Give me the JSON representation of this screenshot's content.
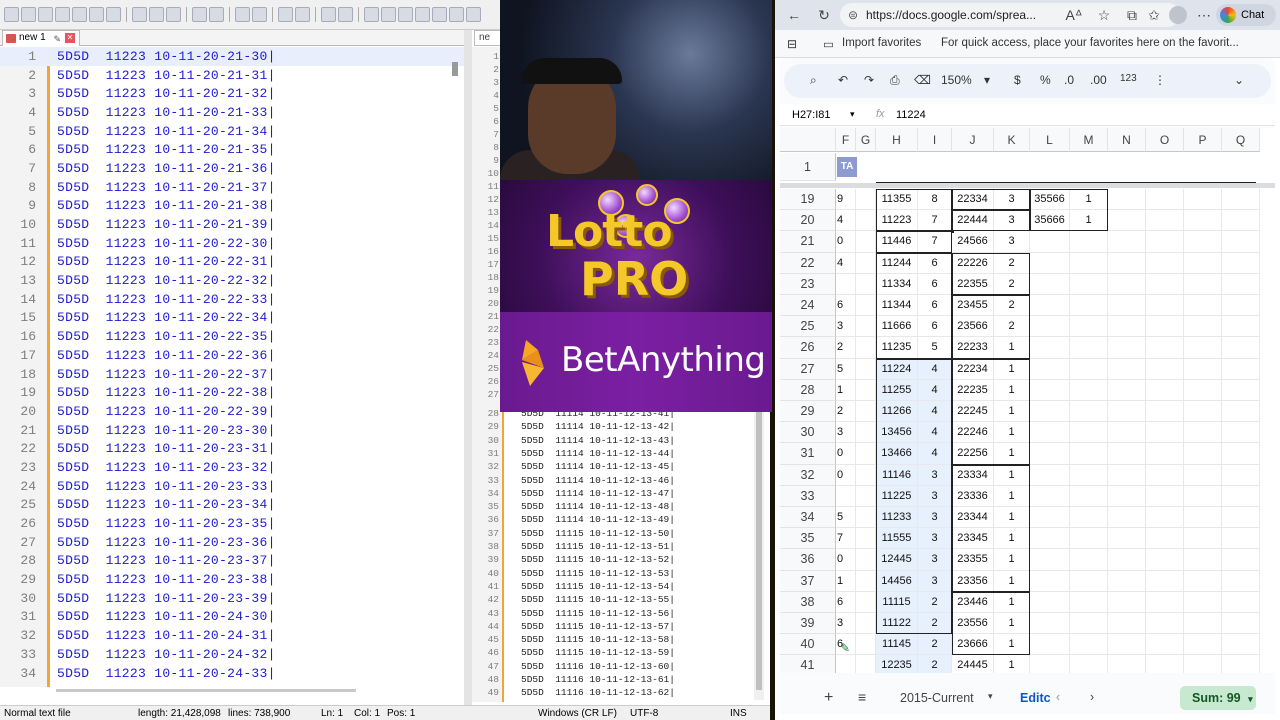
{
  "notepad_left": {
    "tab_label": "new 1",
    "lines": [
      {
        "n": "1",
        "t": "5D5D  11223 10-11-20-21-30|"
      },
      {
        "n": "2",
        "t": "5D5D  11223 10-11-20-21-31|"
      },
      {
        "n": "3",
        "t": "5D5D  11223 10-11-20-21-32|"
      },
      {
        "n": "4",
        "t": "5D5D  11223 10-11-20-21-33|"
      },
      {
        "n": "5",
        "t": "5D5D  11223 10-11-20-21-34|"
      },
      {
        "n": "6",
        "t": "5D5D  11223 10-11-20-21-35|"
      },
      {
        "n": "7",
        "t": "5D5D  11223 10-11-20-21-36|"
      },
      {
        "n": "8",
        "t": "5D5D  11223 10-11-20-21-37|"
      },
      {
        "n": "9",
        "t": "5D5D  11223 10-11-20-21-38|"
      },
      {
        "n": "10",
        "t": "5D5D  11223 10-11-20-21-39|"
      },
      {
        "n": "11",
        "t": "5D5D  11223 10-11-20-22-30|"
      },
      {
        "n": "12",
        "t": "5D5D  11223 10-11-20-22-31|"
      },
      {
        "n": "13",
        "t": "5D5D  11223 10-11-20-22-32|"
      },
      {
        "n": "14",
        "t": "5D5D  11223 10-11-20-22-33|"
      },
      {
        "n": "15",
        "t": "5D5D  11223 10-11-20-22-34|"
      },
      {
        "n": "16",
        "t": "5D5D  11223 10-11-20-22-35|"
      },
      {
        "n": "17",
        "t": "5D5D  11223 10-11-20-22-36|"
      },
      {
        "n": "18",
        "t": "5D5D  11223 10-11-20-22-37|"
      },
      {
        "n": "19",
        "t": "5D5D  11223 10-11-20-22-38|"
      },
      {
        "n": "20",
        "t": "5D5D  11223 10-11-20-22-39|"
      },
      {
        "n": "21",
        "t": "5D5D  11223 10-11-20-23-30|"
      },
      {
        "n": "22",
        "t": "5D5D  11223 10-11-20-23-31|"
      },
      {
        "n": "23",
        "t": "5D5D  11223 10-11-20-23-32|"
      },
      {
        "n": "24",
        "t": "5D5D  11223 10-11-20-23-33|"
      },
      {
        "n": "25",
        "t": "5D5D  11223 10-11-20-23-34|"
      },
      {
        "n": "26",
        "t": "5D5D  11223 10-11-20-23-35|"
      },
      {
        "n": "27",
        "t": "5D5D  11223 10-11-20-23-36|"
      },
      {
        "n": "28",
        "t": "5D5D  11223 10-11-20-23-37|"
      },
      {
        "n": "29",
        "t": "5D5D  11223 10-11-20-23-38|"
      },
      {
        "n": "30",
        "t": "5D5D  11223 10-11-20-23-39|"
      },
      {
        "n": "31",
        "t": "5D5D  11223 10-11-20-24-30|"
      },
      {
        "n": "32",
        "t": "5D5D  11223 10-11-20-24-31|"
      },
      {
        "n": "33",
        "t": "5D5D  11223 10-11-20-24-32|"
      },
      {
        "n": "34",
        "t": "5D5D  11223 10-11-20-24-33|"
      }
    ]
  },
  "notepad_right": {
    "tab_label": "ne",
    "top_numbers": [
      "1",
      "2",
      "3",
      "4",
      "5",
      "6",
      "7",
      "8",
      "9",
      "10",
      "11",
      "12",
      "13",
      "14",
      "15",
      "16",
      "17",
      "18",
      "19",
      "20",
      "21",
      "22",
      "23",
      "24",
      "25",
      "26",
      "27"
    ],
    "lines": [
      {
        "n": "28",
        "t": "5D5D  11114 10-11-12-13-41|"
      },
      {
        "n": "29",
        "t": "5D5D  11114 10-11-12-13-42|"
      },
      {
        "n": "30",
        "t": "5D5D  11114 10-11-12-13-43|"
      },
      {
        "n": "31",
        "t": "5D5D  11114 10-11-12-13-44|"
      },
      {
        "n": "32",
        "t": "5D5D  11114 10-11-12-13-45|"
      },
      {
        "n": "33",
        "t": "5D5D  11114 10-11-12-13-46|"
      },
      {
        "n": "34",
        "t": "5D5D  11114 10-11-12-13-47|"
      },
      {
        "n": "35",
        "t": "5D5D  11114 10-11-12-13-48|"
      },
      {
        "n": "36",
        "t": "5D5D  11114 10-11-12-13-49|"
      },
      {
        "n": "37",
        "t": "5D5D  11115 10-11-12-13-50|"
      },
      {
        "n": "38",
        "t": "5D5D  11115 10-11-12-13-51|"
      },
      {
        "n": "39",
        "t": "5D5D  11115 10-11-12-13-52|"
      },
      {
        "n": "40",
        "t": "5D5D  11115 10-11-12-13-53|"
      },
      {
        "n": "41",
        "t": "5D5D  11115 10-11-12-13-54|"
      },
      {
        "n": "42",
        "t": "5D5D  11115 10-11-12-13-55|"
      },
      {
        "n": "43",
        "t": "5D5D  11115 10-11-12-13-56|"
      },
      {
        "n": "44",
        "t": "5D5D  11115 10-11-12-13-57|"
      },
      {
        "n": "45",
        "t": "5D5D  11115 10-11-12-13-58|"
      },
      {
        "n": "46",
        "t": "5D5D  11115 10-11-12-13-59|"
      },
      {
        "n": "47",
        "t": "5D5D  11116 10-11-12-13-60|"
      },
      {
        "n": "48",
        "t": "5D5D  11116 10-11-12-13-61|"
      },
      {
        "n": "49",
        "t": "5D5D  11116 10-11-12-13-62|"
      }
    ]
  },
  "status_bar": {
    "file_type": "Normal text file",
    "length": "length: 21,428,098",
    "lines": "lines: 738,900",
    "ln": "Ln: 1",
    "col": "Col: 1",
    "pos": "Pos: 1",
    "eol": "Windows (CR LF)",
    "encoding": "UTF-8",
    "mode": "INS"
  },
  "banners": {
    "lotto_line1": "Lotto",
    "lotto_line2": "PRO",
    "bet_name": "BetAnything"
  },
  "browser": {
    "url": "https://docs.google.com/sprea...",
    "import_favorites": "Import favorites",
    "favorites_hint": "For quick access, place your favorites here on the favorit...",
    "chat_label": "Chat"
  },
  "sheets": {
    "zoom": "150%",
    "currency": "$",
    "percent": "%",
    "dec_less": ".0",
    "dec_more": ".00",
    "number_format": "123",
    "name_box": "H27:I81",
    "fx_value": "11224",
    "columns": [
      "F",
      "G",
      "H",
      "I",
      "J",
      "K",
      "L",
      "M",
      "N",
      "O",
      "P",
      "Q"
    ],
    "row1_label": "1",
    "row1_f": "TA",
    "rows": [
      {
        "r": "19",
        "f": "9",
        "h": "11355",
        "i": "8",
        "j": "22334",
        "k": "3",
        "l": "35566",
        "m": "1"
      },
      {
        "r": "20",
        "f": "4",
        "h": "11223",
        "i": "7",
        "j": "22444",
        "k": "3",
        "l": "35666",
        "m": "1"
      },
      {
        "r": "21",
        "f": "0",
        "h": "11446",
        "i": "7",
        "j": "24566",
        "k": "3",
        "l": "",
        "m": ""
      },
      {
        "r": "22",
        "f": "4",
        "h": "11244",
        "i": "6",
        "j": "22226",
        "k": "2",
        "l": "",
        "m": ""
      },
      {
        "r": "23",
        "f": "",
        "h": "11334",
        "i": "6",
        "j": "22355",
        "k": "2",
        "l": "",
        "m": ""
      },
      {
        "r": "24",
        "f": "6",
        "h": "11344",
        "i": "6",
        "j": "23455",
        "k": "2",
        "l": "",
        "m": ""
      },
      {
        "r": "25",
        "f": "3",
        "h": "11666",
        "i": "6",
        "j": "23566",
        "k": "2",
        "l": "",
        "m": ""
      },
      {
        "r": "26",
        "f": "2",
        "h": "11235",
        "i": "5",
        "j": "22233",
        "k": "1",
        "l": "",
        "m": ""
      },
      {
        "r": "27",
        "f": "5",
        "h": "11224",
        "i": "4",
        "j": "22234",
        "k": "1",
        "l": "",
        "m": ""
      },
      {
        "r": "28",
        "f": "1",
        "h": "11255",
        "i": "4",
        "j": "22235",
        "k": "1",
        "l": "",
        "m": ""
      },
      {
        "r": "29",
        "f": "2",
        "h": "11266",
        "i": "4",
        "j": "22245",
        "k": "1",
        "l": "",
        "m": ""
      },
      {
        "r": "30",
        "f": "3",
        "h": "13456",
        "i": "4",
        "j": "22246",
        "k": "1",
        "l": "",
        "m": ""
      },
      {
        "r": "31",
        "f": "0",
        "h": "13466",
        "i": "4",
        "j": "22256",
        "k": "1",
        "l": "",
        "m": ""
      },
      {
        "r": "32",
        "f": "0",
        "h": "11146",
        "i": "3",
        "j": "23334",
        "k": "1",
        "l": "",
        "m": ""
      },
      {
        "r": "33",
        "f": "",
        "h": "11225",
        "i": "3",
        "j": "23336",
        "k": "1",
        "l": "",
        "m": ""
      },
      {
        "r": "34",
        "f": "5",
        "h": "11233",
        "i": "3",
        "j": "23344",
        "k": "1",
        "l": "",
        "m": ""
      },
      {
        "r": "35",
        "f": "7",
        "h": "11555",
        "i": "3",
        "j": "23345",
        "k": "1",
        "l": "",
        "m": ""
      },
      {
        "r": "36",
        "f": "0",
        "h": "12445",
        "i": "3",
        "j": "23355",
        "k": "1",
        "l": "",
        "m": ""
      },
      {
        "r": "37",
        "f": "1",
        "h": "14456",
        "i": "3",
        "j": "23356",
        "k": "1",
        "l": "",
        "m": ""
      },
      {
        "r": "38",
        "f": "6",
        "h": "11115",
        "i": "2",
        "j": "23446",
        "k": "1",
        "l": "",
        "m": ""
      },
      {
        "r": "39",
        "f": "3",
        "h": "11122",
        "i": "2",
        "j": "23556",
        "k": "1",
        "l": "",
        "m": ""
      },
      {
        "r": "40",
        "f": "6",
        "h": "11145",
        "i": "2",
        "j": "23666",
        "k": "1",
        "l": "",
        "m": ""
      },
      {
        "r": "41",
        "f": "",
        "h": "12235",
        "i": "2",
        "j": "24445",
        "k": "1",
        "l": "",
        "m": ""
      }
    ],
    "sheet_tab": "2015-Current",
    "sheet_tab2": "Editc",
    "sum": "Sum: 99"
  }
}
